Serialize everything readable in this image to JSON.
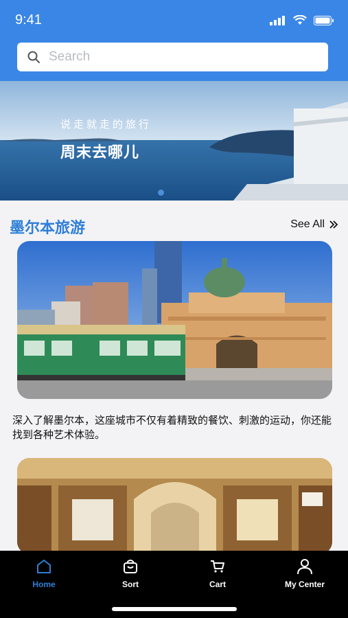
{
  "status_bar": {
    "time": "9:41"
  },
  "search": {
    "placeholder": "Search"
  },
  "banner": {
    "subtitle": "说走就走的旅行",
    "title": "周末去哪儿"
  },
  "section": {
    "title": "墨尔本旅游",
    "see_all": "See All"
  },
  "cards": [
    {
      "image_icon": "melbourne-tram-station-photo",
      "description": "深入了解墨尔本，这座城市不仅有着精致的餐饮、刺激的运动，你还能找到各种艺术体验。"
    },
    {
      "image_icon": "shopping-arcade-photo"
    }
  ],
  "tabs": [
    {
      "label": "Home",
      "icon": "home-icon",
      "active": true
    },
    {
      "label": "Sort",
      "icon": "bag-icon",
      "active": false
    },
    {
      "label": "Cart",
      "icon": "cart-icon",
      "active": false
    },
    {
      "label": "My Center",
      "icon": "user-icon",
      "active": false
    }
  ],
  "colors": {
    "accent": "#3a86e6",
    "tab_active": "#2f7fd8",
    "tabbar_bg": "#000000"
  }
}
